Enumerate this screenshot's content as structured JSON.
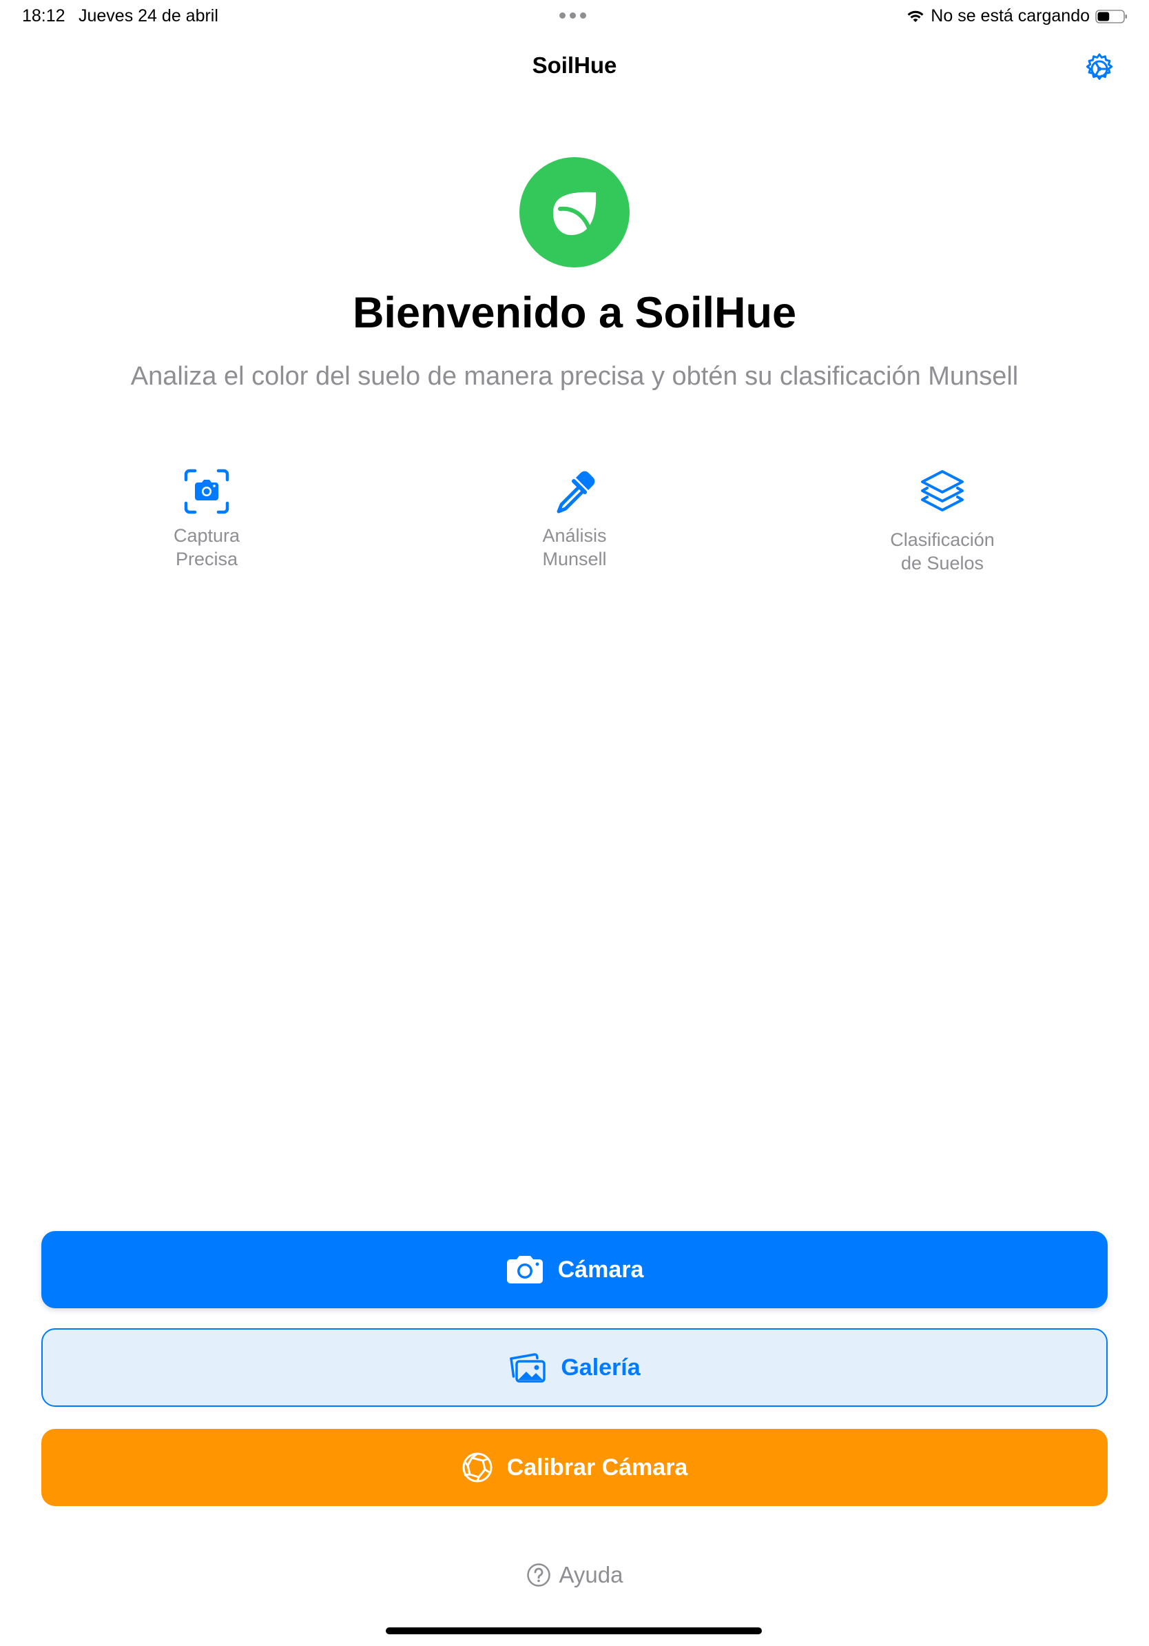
{
  "status_bar": {
    "time": "18:12",
    "date": "Jueves 24 de abril",
    "charging_status": "No se está cargando",
    "battery_level": 0.45
  },
  "nav": {
    "title": "SoilHue",
    "settings_icon": "gear-icon"
  },
  "hero": {
    "logo_icon": "leaf-icon",
    "title": "Bienvenido a SoilHue",
    "subtitle": "Analiza el color del suelo de manera precisa y obtén su clasificación Munsell"
  },
  "features": [
    {
      "icon": "camera-viewfinder-icon",
      "label": "Captura\nPrecisa"
    },
    {
      "icon": "eyedropper-icon",
      "label": "Análisis\nMunsell"
    },
    {
      "icon": "layers-icon",
      "label": "Clasificación\nde Suelos"
    }
  ],
  "actions": {
    "camera_label": "Cámara",
    "gallery_label": "Galería",
    "calibrate_label": "Calibrar Cámara",
    "help_label": "Ayuda"
  },
  "colors": {
    "accent_blue": "#007aff",
    "logo_green": "#34c759",
    "calibrate_orange": "#ff9500",
    "gallery_bg": "#e3f0fc",
    "secondary_text": "#8e8e93"
  }
}
